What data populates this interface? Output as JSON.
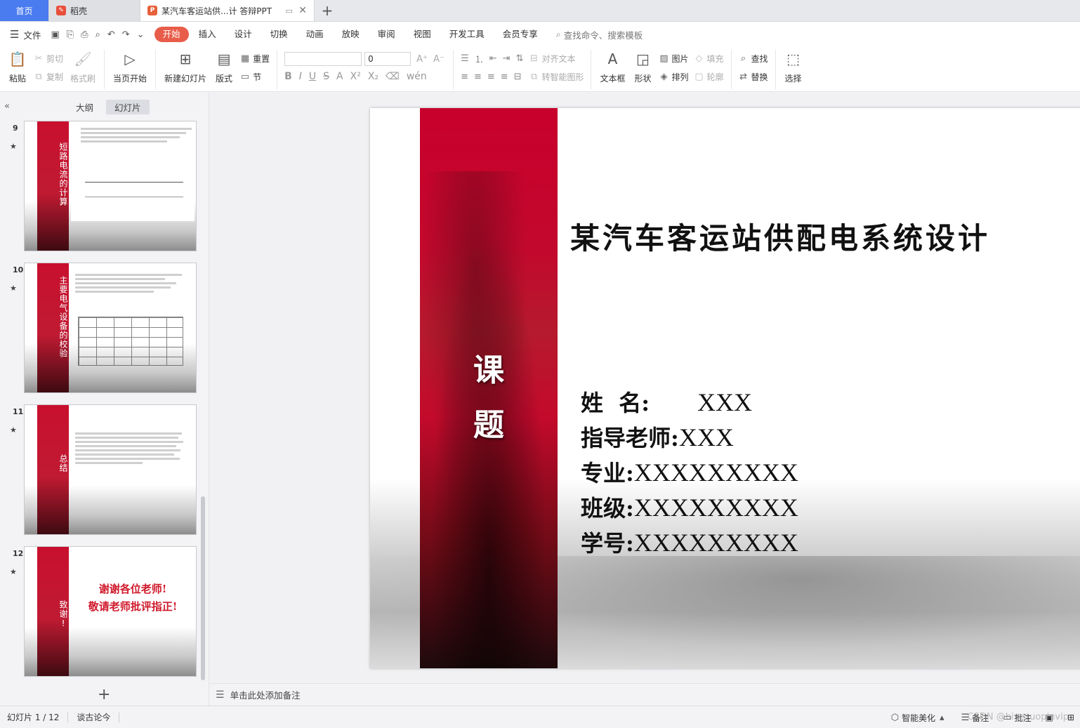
{
  "tabs": {
    "home": "首页",
    "daoke": "稻壳",
    "doc": "某汽车客运站供...计 答辩PPT"
  },
  "menu": {
    "file": "文件",
    "items": [
      "开始",
      "插入",
      "设计",
      "切换",
      "动画",
      "放映",
      "审阅",
      "视图",
      "开发工具",
      "会员专享"
    ],
    "search": "查找命令、搜索模板"
  },
  "ribbon": {
    "paste": "粘贴",
    "cut": "剪切",
    "copy": "复制",
    "format_painter": "格式刷",
    "from_start": "当页开始",
    "new_slide": "新建幻灯片",
    "layout": "版式",
    "reset": "重置",
    "section": "节",
    "font_size": "0",
    "align_text": "对齐文本",
    "smart_art": "转智能图形",
    "textbox": "文本框",
    "shape": "形状",
    "picture": "图片",
    "arrange": "排列",
    "fill": "填充",
    "outline": "轮廓",
    "find": "查找",
    "replace": "替换",
    "select": "选择"
  },
  "panel": {
    "outline_tab": "大纲",
    "slides_tab": "幻灯片"
  },
  "thumbnails": [
    {
      "num": "9",
      "title": "短路电流的计算"
    },
    {
      "num": "10",
      "title": "主要电气设备的校验"
    },
    {
      "num": "11",
      "title": "总结"
    },
    {
      "num": "12",
      "title": "致谢!",
      "thanks_1": "谢谢各位老师!",
      "thanks_2": "敬请老师批评指正!"
    }
  ],
  "slide": {
    "band_title_1": "课",
    "band_title_2": "题",
    "title": "某汽车客运站供配电系统设计",
    "rows": [
      {
        "label": "姓  名:",
        "value": "XXX"
      },
      {
        "label": "指导老师:",
        "value": "XXX"
      },
      {
        "label": "专业:",
        "value": "XXXXXXXXX"
      },
      {
        "label": "班级:",
        "value": "XXXXXXXXX"
      },
      {
        "label": "学号:",
        "value": "XXXXXXXXX"
      }
    ]
  },
  "notes": {
    "placeholder": "单击此处添加备注"
  },
  "status": {
    "slide_counter": "幻灯片 1 / 12",
    "theme": "谈古论今",
    "beautify": "智能美化",
    "notes": "备注",
    "annotate": "批注",
    "watermark": "CSDN @biyezuopinvip"
  },
  "colors": {
    "accent": "#e85d4a",
    "home_tab": "#4a7cf0",
    "band_red": "#c8002c"
  }
}
